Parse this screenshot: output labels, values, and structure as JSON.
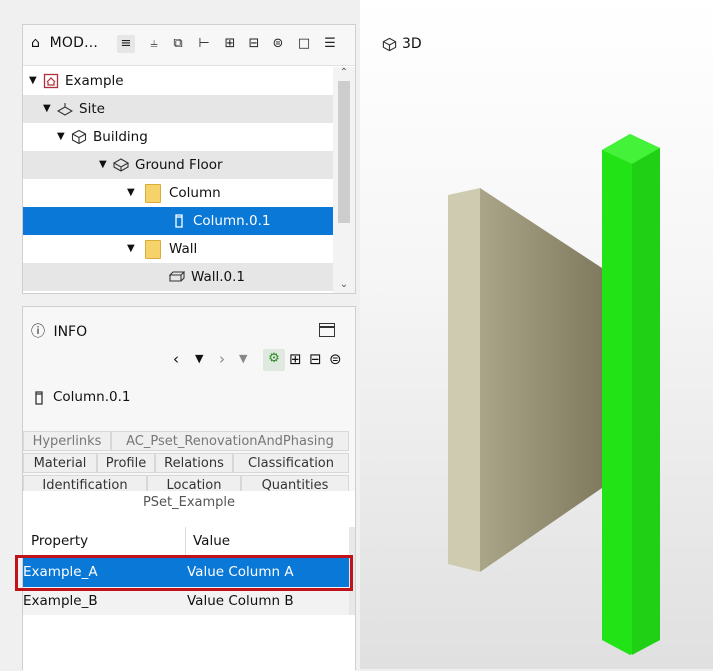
{
  "model_panel": {
    "title": "MOD...",
    "toolbar_icons": [
      "tree-view-icon",
      "structure-icon",
      "layers-icon",
      "hierarchy-icon",
      "expand-all-icon",
      "collapse-all-icon",
      "details-icon",
      "maximize-icon"
    ]
  },
  "tree": {
    "items": [
      {
        "label": "Example",
        "icon": "project-icon",
        "expanded": true
      },
      {
        "label": "Site",
        "icon": "site-icon",
        "expanded": true
      },
      {
        "label": "Building",
        "icon": "building-icon",
        "expanded": true
      },
      {
        "label": "Ground Floor",
        "icon": "storey-icon",
        "expanded": true
      },
      {
        "label": "Column",
        "icon": "folder-icon",
        "expanded": true
      },
      {
        "label": "Column.0.1",
        "icon": "column-icon",
        "selected": true
      },
      {
        "label": "Wall",
        "icon": "folder-icon",
        "expanded": true
      },
      {
        "label": "Wall.0.1",
        "icon": "wall-icon"
      }
    ]
  },
  "info_panel": {
    "title": "INFO",
    "entity": "Column.0.1",
    "tabs_row1": [
      "Hyperlinks",
      "AC_Pset_RenovationAndPhasing"
    ],
    "tabs_row2": [
      "Material",
      "Profile",
      "Relations",
      "Classification"
    ],
    "tabs_row3": [
      "Identification",
      "Location",
      "Quantities"
    ],
    "pset_title": "PSet_Example",
    "table": {
      "headers": [
        "Property",
        "Value"
      ],
      "rows": [
        [
          "Example_A",
          "Value Column A"
        ],
        [
          "Example_B",
          "Value Column B"
        ]
      ]
    }
  },
  "viewport": {
    "title": "3D",
    "colors": {
      "column": "#2ee61a",
      "wall": "#bdb99d"
    }
  }
}
